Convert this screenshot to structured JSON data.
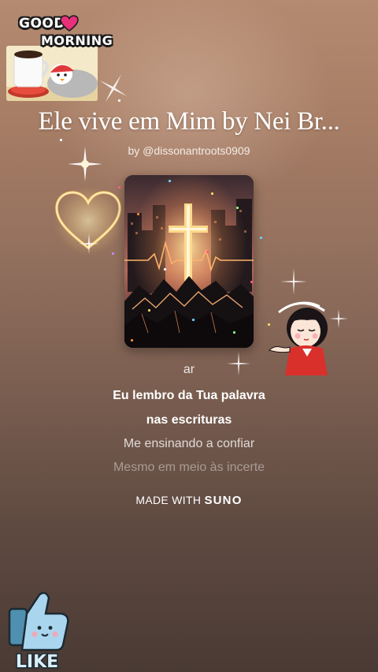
{
  "sticker_top": {
    "line1": "GOOD",
    "line2": "MORNING"
  },
  "song": {
    "title": "Ele vive em Mim by Nei Br...",
    "byline": "by @dissonantroots0909"
  },
  "lyrics": {
    "previous": "ar",
    "current_line1": "Eu lembro da Tua palavra",
    "current_line2": "nas escrituras",
    "next": "Me ensinando a confiar",
    "next2": "Mesmo em meio às incerte"
  },
  "footer": {
    "prefix": "MADE WITH",
    "brand": "SUNO"
  },
  "sticker_bottom": {
    "label": "LIKE"
  },
  "colors": {
    "background_top": "#b48a70",
    "background_bottom": "#4a3a34",
    "heart_pink": "#e8307a",
    "gold": "#f7c96b"
  }
}
